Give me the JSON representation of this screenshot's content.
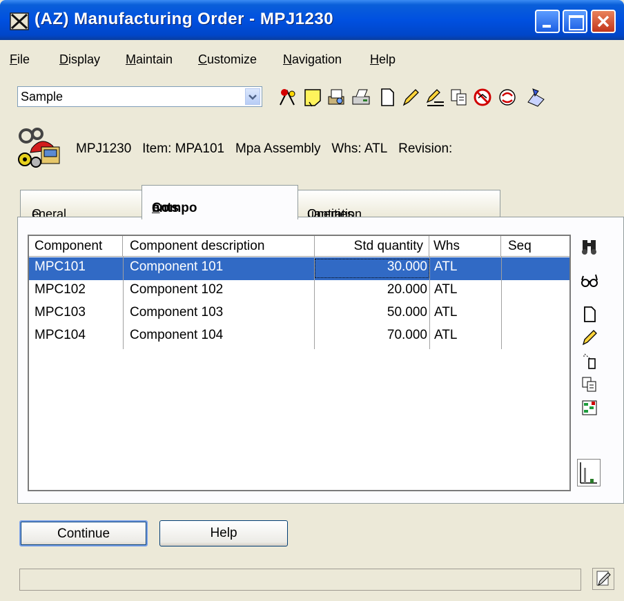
{
  "window": {
    "title": "(AZ) Manufacturing Order - MPJ1230"
  },
  "menu": [
    {
      "hot": "F",
      "rest": "ile"
    },
    {
      "hot": "D",
      "rest": "isplay"
    },
    {
      "hot": "M",
      "rest": "aintain"
    },
    {
      "hot": "C",
      "rest": "ustomize"
    },
    {
      "hot": "N",
      "rest": "avigation"
    },
    {
      "hot": "H",
      "rest": "elp"
    }
  ],
  "toolbar": {
    "view_value": "Sample"
  },
  "header": {
    "order": "MPJ1230",
    "item_label": "Item:",
    "item": "MPA101",
    "description": "Mpa Assembly",
    "whs_label": "Whs:",
    "whs": "ATL",
    "revision_label": "Revision:"
  },
  "tabs": [
    {
      "pre": "",
      "hot": "G",
      "post": "eneral"
    },
    {
      "pre": "Compo",
      "hot": "n",
      "post": "ents"
    },
    {
      "pre": "Operation ",
      "hot": "Q",
      "post": "uantities"
    }
  ],
  "grid": {
    "columns": [
      "Component",
      "Component description",
      "Std quantity",
      "Whs",
      "Seq"
    ],
    "rows": [
      {
        "component": "MPC101",
        "description": "Component 101",
        "qty": "30.000",
        "whs": "ATL",
        "seq": ""
      },
      {
        "component": "MPC102",
        "description": "Component 102",
        "qty": "20.000",
        "whs": "ATL",
        "seq": ""
      },
      {
        "component": "MPC103",
        "description": "Component 103",
        "qty": "50.000",
        "whs": "ATL",
        "seq": ""
      },
      {
        "component": "MPC104",
        "description": "Component 104",
        "qty": "70.000",
        "whs": "ATL",
        "seq": ""
      }
    ],
    "selected_row": 0
  },
  "buttons": {
    "continue": "Continue",
    "help": "Help"
  },
  "status": {
    "text": ""
  },
  "colors": {
    "selection": "#316ac5",
    "titlebar": "#0050e0",
    "window_bg": "#ece9d8"
  }
}
